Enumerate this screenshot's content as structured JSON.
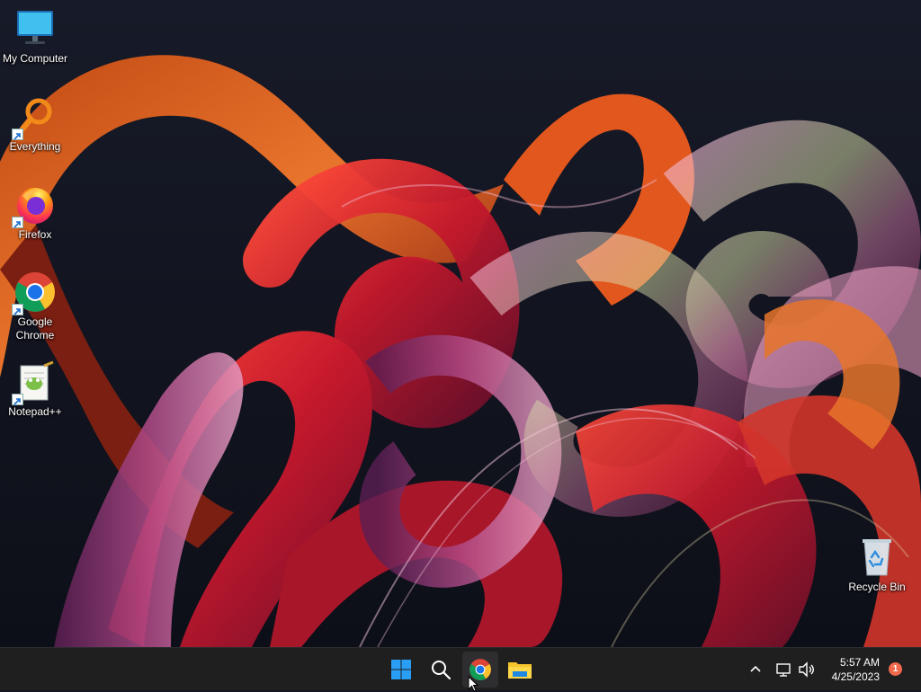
{
  "desktop": {
    "icons": [
      {
        "label": "My Computer"
      },
      {
        "label": "Everything"
      },
      {
        "label": "Firefox"
      },
      {
        "label": "Google Chrome"
      },
      {
        "label": "Notepad++"
      }
    ],
    "recycle_bin": {
      "label": "Recycle Bin"
    }
  },
  "taskbar": {
    "pinned": [
      "start-icon",
      "search-icon",
      "chrome-icon",
      "file-explorer-icon"
    ],
    "tray": {
      "time": "5:57 AM",
      "date": "4/25/2023",
      "notification_count": "1"
    }
  },
  "colors": {
    "taskbar_bg": "#1f1f20",
    "wallpaper_bg": "#121420",
    "accent_orange": "#e8602c",
    "accent_red": "#d6243a",
    "accent_purple": "#8b3a7a",
    "windows_blue": "#1e90ff"
  }
}
